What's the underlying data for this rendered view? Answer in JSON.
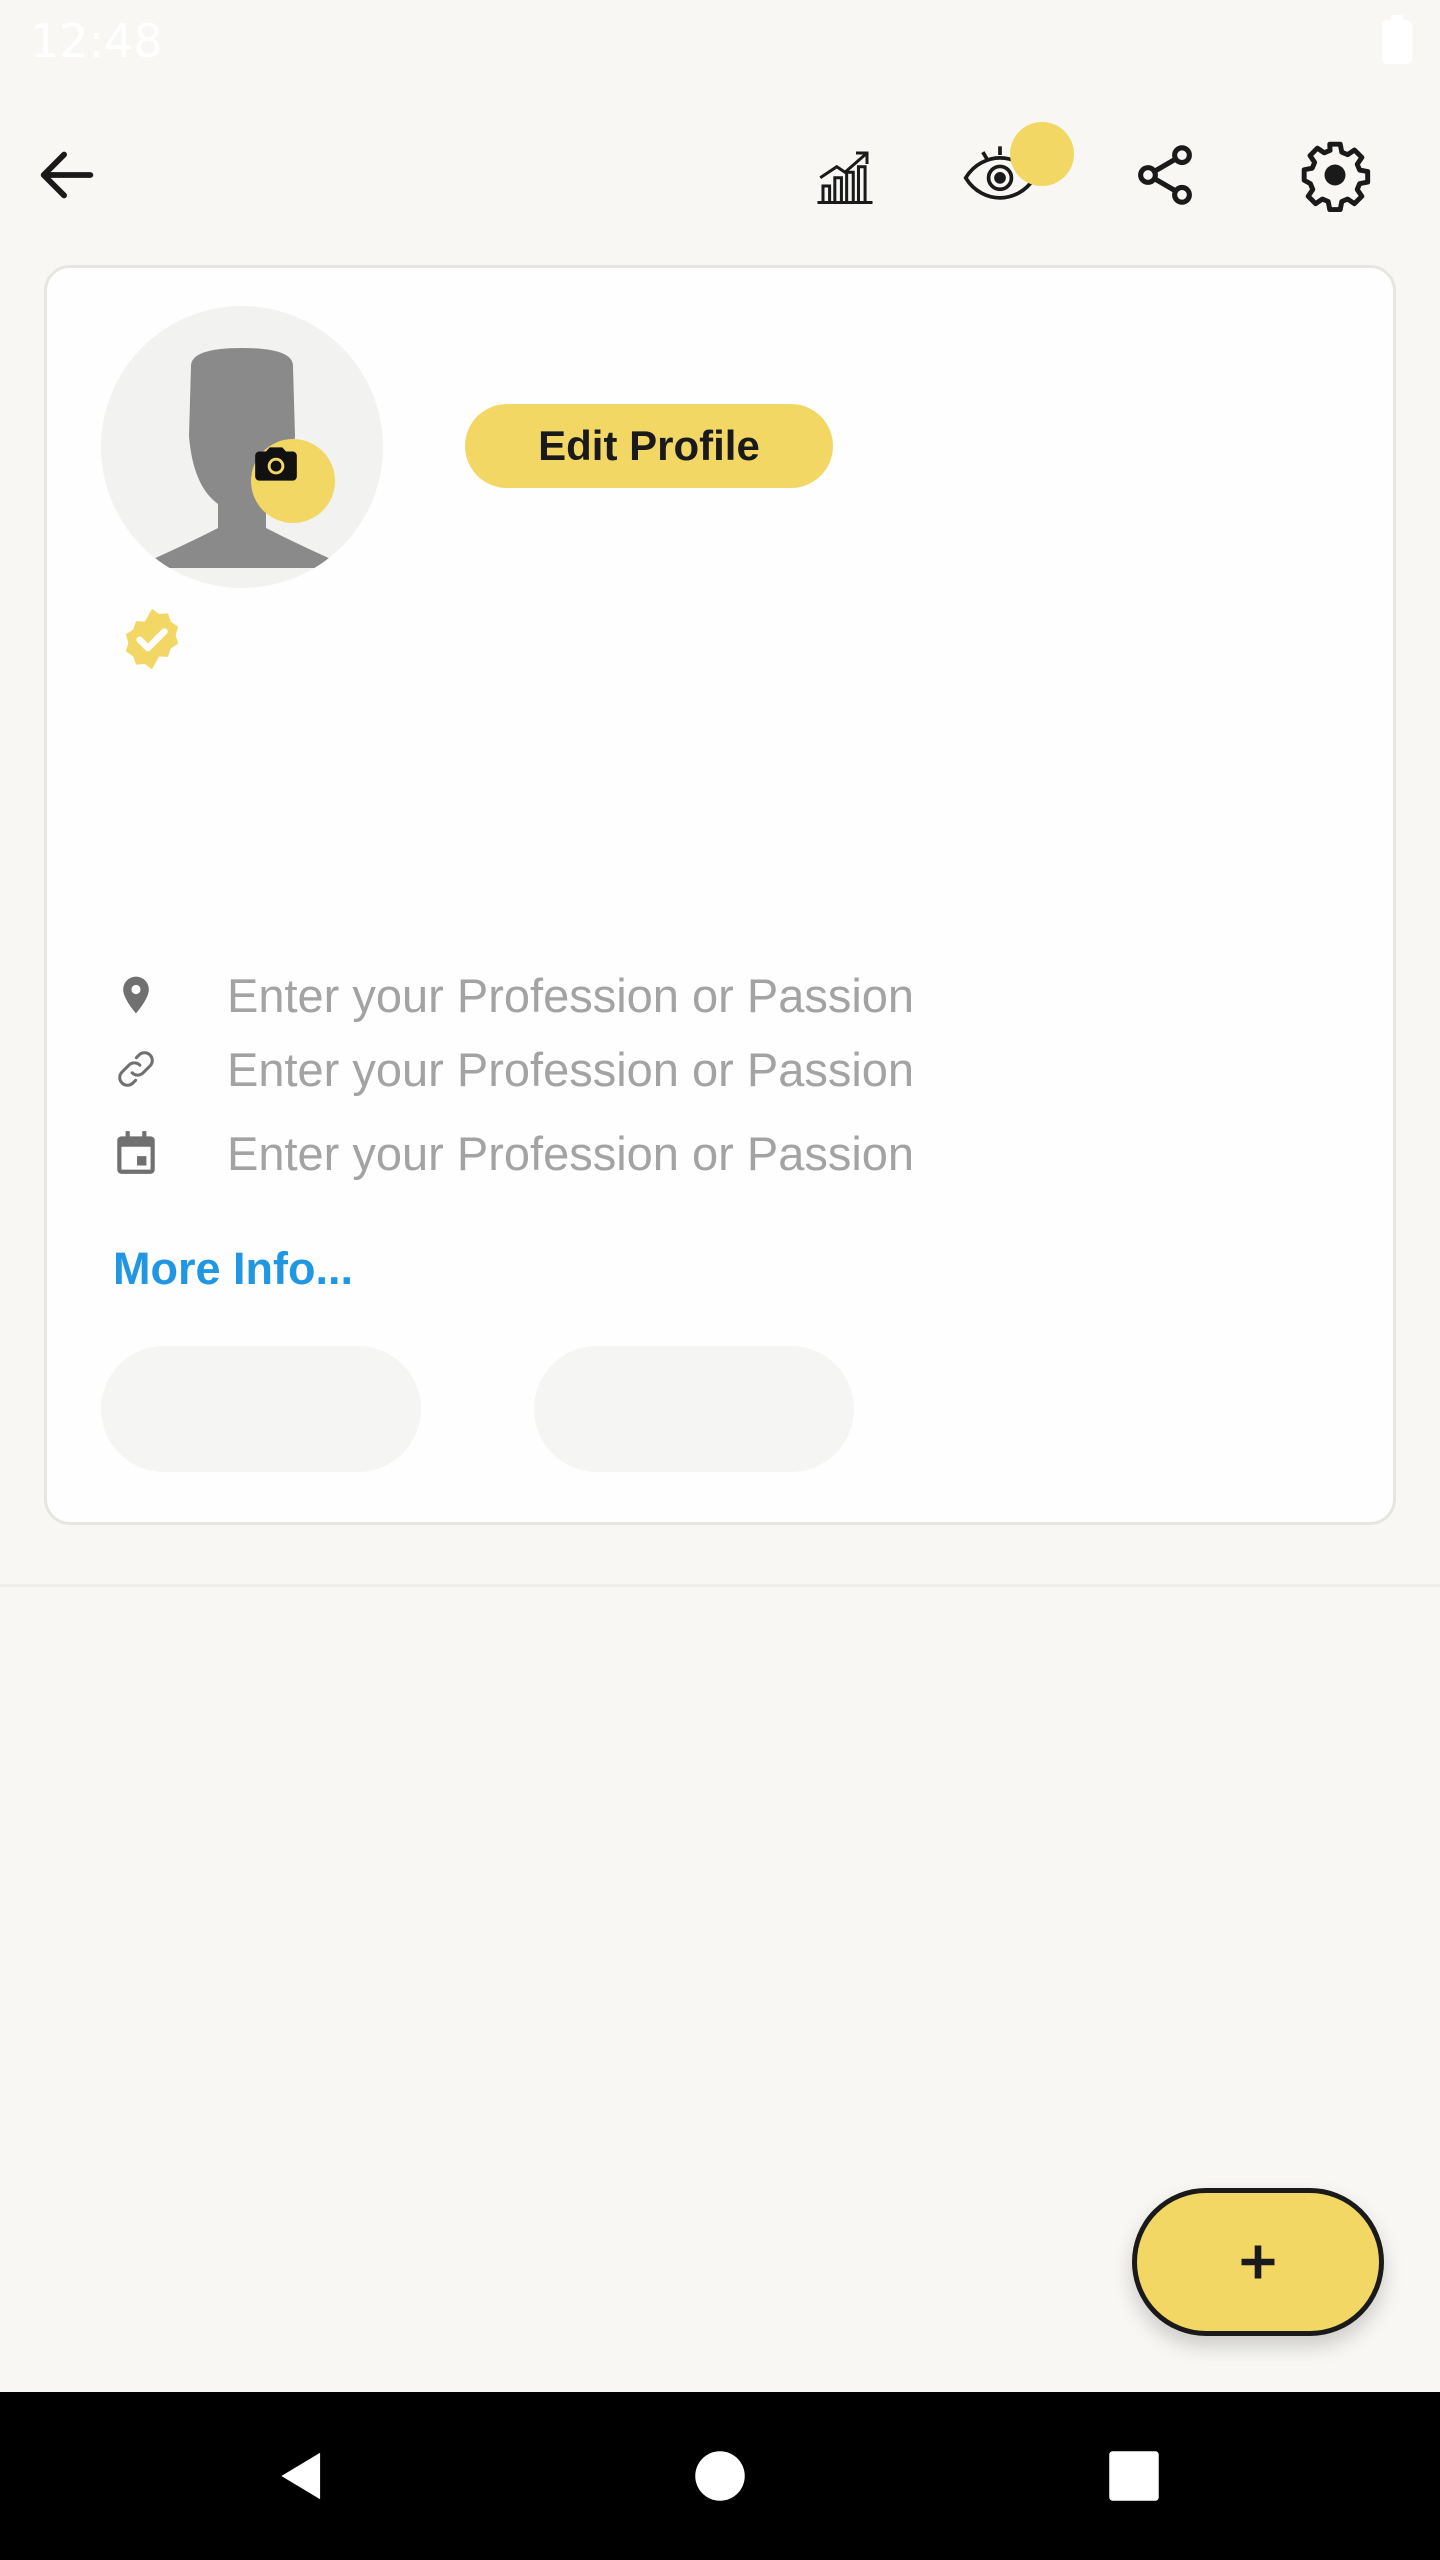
{
  "status_bar": {
    "time": "12:48"
  },
  "top_bar": {
    "icons": [
      "arrow-left-icon",
      "analytics-chart-icon",
      "eye-icon",
      "share-icon",
      "settings-gear-icon"
    ]
  },
  "profile": {
    "edit_button_label": "Edit Profile",
    "avatar_icon": "person-silhouette-icon",
    "camera_icon": "camera-icon",
    "verified_icon": "verified-check-icon",
    "fields": [
      {
        "icon": "location-pin-icon",
        "value": "",
        "placeholder": "Enter your Profession or Passion"
      },
      {
        "icon": "link-icon",
        "value": "",
        "placeholder": "Enter your Profession or Passion"
      },
      {
        "icon": "calendar-icon",
        "value": "",
        "placeholder": "Enter your Profession or Passion"
      }
    ],
    "more_info_label": "More Info..."
  },
  "fab": {
    "label": "+"
  },
  "colors": {
    "accent_yellow": "#f2d765",
    "link_blue": "#2196e3",
    "background": "#f8f7f4",
    "card": "#fefefe",
    "placeholder_gray": "#a3a3a3"
  },
  "nav_bar": {
    "icons": [
      "nav-back-icon",
      "nav-home-icon",
      "nav-recents-icon"
    ]
  }
}
